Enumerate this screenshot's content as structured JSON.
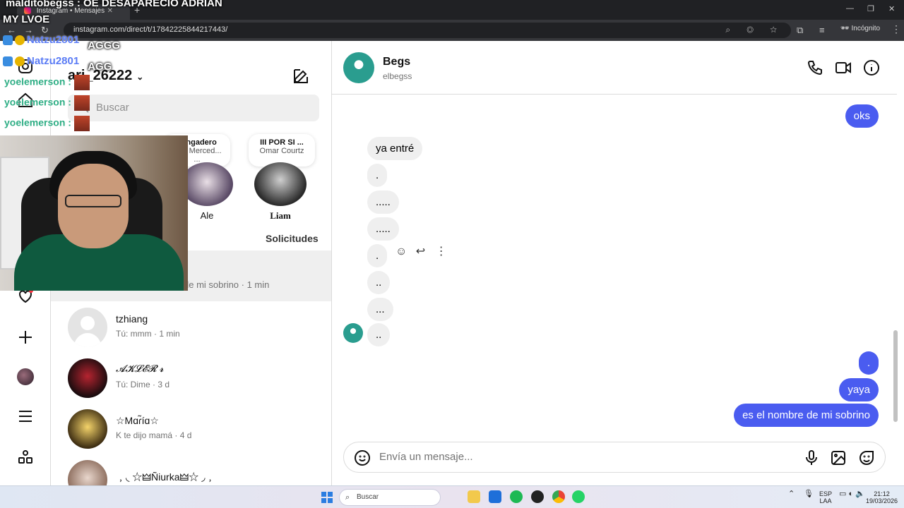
{
  "browser": {
    "tab_title": "Instagram • Mensajes",
    "url": "instagram.com/direct/t/17842225844217443/",
    "incognito_label": "Incógnito"
  },
  "overlay": {
    "top_line": "malditobegss : OE DESAPARECIO ADRIAN",
    "second_line": "MY LVOE",
    "natzu_lines": [
      {
        "user": "Natzu2801",
        "sep": " : ",
        "text": "AGGG"
      },
      {
        "user": "Natzu2801",
        "sep": " : ",
        "text": "AGG"
      }
    ],
    "yoel_lines": [
      {
        "user": "yoelemerson",
        "sep": " :"
      },
      {
        "user": "yoelemerson",
        "sep": " :"
      },
      {
        "user": "yoelemerson",
        "sep": " :"
      }
    ]
  },
  "sidebar": {
    "username": "ari_26222",
    "search_placeholder": "Buscar",
    "requests_label": "Solicitudes"
  },
  "notes": [
    {
      "title": "Jangadero",
      "sub": "lo J, Merced...",
      "extra": "...",
      "name": "Ale"
    },
    {
      "title": "III POR SI ...",
      "sub": "Omar Courtz",
      "extra": "",
      "name": "Liam"
    }
  ],
  "active_preview": "de mi sobrino · 1 min",
  "threads": [
    {
      "name": "tzhiang",
      "preview": "Tú: mmm · 1 min"
    },
    {
      "name": "𝓐𝓚𝓛𝓔𝓡 𝓻",
      "preview": "Tú: Dime · 3 d"
    },
    {
      "name": "☆Mɑɾ̃íɑ☆",
      "preview": "K te dijo mamá · 4 d"
    },
    {
      "name": "﹐◟ ☆🜲Ñiurka🜲☆ ◞﹐",
      "preview": ""
    }
  ],
  "chat": {
    "contact_name": "Begs",
    "contact_handle": "elbegss",
    "messages": [
      {
        "dir": "out",
        "text": "oks"
      },
      {
        "dir": "in",
        "text": "ya entré"
      },
      {
        "dir": "in",
        "text": "."
      },
      {
        "dir": "in",
        "text": "....."
      },
      {
        "dir": "in",
        "text": "....."
      },
      {
        "dir": "in",
        "text": "."
      },
      {
        "dir": "in",
        "text": ".."
      },
      {
        "dir": "in",
        "text": "..."
      },
      {
        "dir": "in",
        "text": ".."
      },
      {
        "dir": "out",
        "text": "."
      },
      {
        "dir": "out",
        "text": "yaya"
      },
      {
        "dir": "out",
        "text": "es el nombre de mi sobrino"
      }
    ],
    "composer_placeholder": "Envía un mensaje..."
  },
  "taskbar": {
    "search_label": "Buscar",
    "lang_top": "ESP",
    "lang_bottom": "LAA",
    "time": "21:12",
    "date": "19/03/2026"
  },
  "colors": {
    "outgoing_bubble": "#4a5cf0",
    "incoming_bubble": "#efefef",
    "notification_dot": "#ff3040"
  }
}
